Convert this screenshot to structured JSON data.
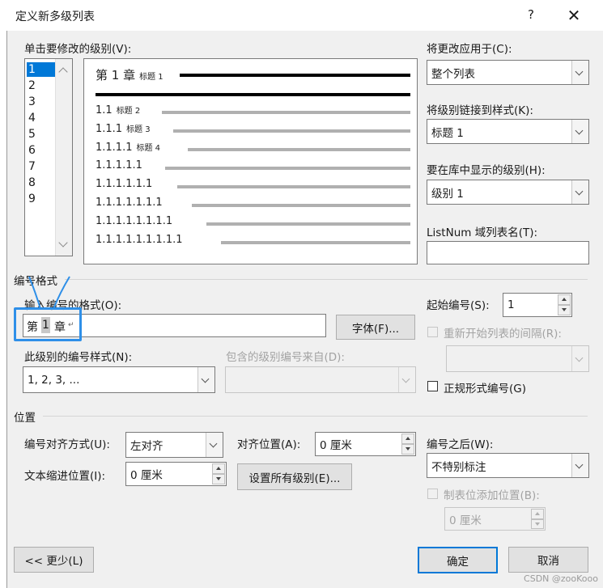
{
  "window": {
    "title": "定义新多级列表",
    "help": "?",
    "close": "✕"
  },
  "levels_label": "单击要修改的级别(V):",
  "levels": [
    "1",
    "2",
    "3",
    "4",
    "5",
    "6",
    "7",
    "8",
    "9"
  ],
  "preview": {
    "rows": [
      {
        "num": "第 1 章",
        "heading": "标题 1"
      },
      {
        "num": "1.1",
        "heading": "标题 2"
      },
      {
        "num": "1.1.1",
        "heading": "标题 3"
      },
      {
        "num": "1.1.1.1",
        "heading": "标题 4"
      },
      {
        "num": "1.1.1.1.1",
        "heading": ""
      },
      {
        "num": "1.1.1.1.1.1",
        "heading": ""
      },
      {
        "num": "1.1.1.1.1.1.1",
        "heading": ""
      },
      {
        "num": "1.1.1.1.1.1.1.1",
        "heading": ""
      },
      {
        "num": "1.1.1.1.1.1.1.1.1",
        "heading": ""
      }
    ]
  },
  "apply_to": {
    "label": "将更改应用于(C):",
    "value": "整个列表"
  },
  "link_style": {
    "label": "将级别链接到样式(K):",
    "value": "标题 1"
  },
  "gallery_level": {
    "label": "要在库中显示的级别(H):",
    "value": "级别 1"
  },
  "listnum": {
    "label": "ListNum 域列表名(T):",
    "value": ""
  },
  "number_format": {
    "section": "编号格式",
    "format_label": "输入编号的格式(O):",
    "format_prefix": "第",
    "format_num": "1",
    "format_suffix": "章",
    "font_button": "字体(F)...",
    "style_label": "此级别的编号样式(N):",
    "style_value": "1, 2, 3, ...",
    "include_label": "包含的级别编号来自(D):",
    "include_value": ""
  },
  "start_at": {
    "label": "起始编号(S):",
    "value": "1"
  },
  "restart": {
    "label": "重新开始列表的间隔(R):",
    "value": ""
  },
  "legal": {
    "label": "正规形式编号(G)"
  },
  "position": {
    "section": "位置",
    "align_label": "编号对齐方式(U):",
    "align_value": "左对齐",
    "at_label": "对齐位置(A):",
    "at_value": "0 厘米",
    "indent_label": "文本缩进位置(I):",
    "indent_value": "0 厘米",
    "set_all_button": "设置所有级别(E)...",
    "follow_label": "编号之后(W):",
    "follow_value": "不特别标注",
    "tab_label": "制表位添加位置(B):",
    "tab_value": "0 厘米"
  },
  "buttons": {
    "less": "<< 更少(L)",
    "ok": "确定",
    "cancel": "取消"
  },
  "watermark": "CSDN @zooKooo"
}
